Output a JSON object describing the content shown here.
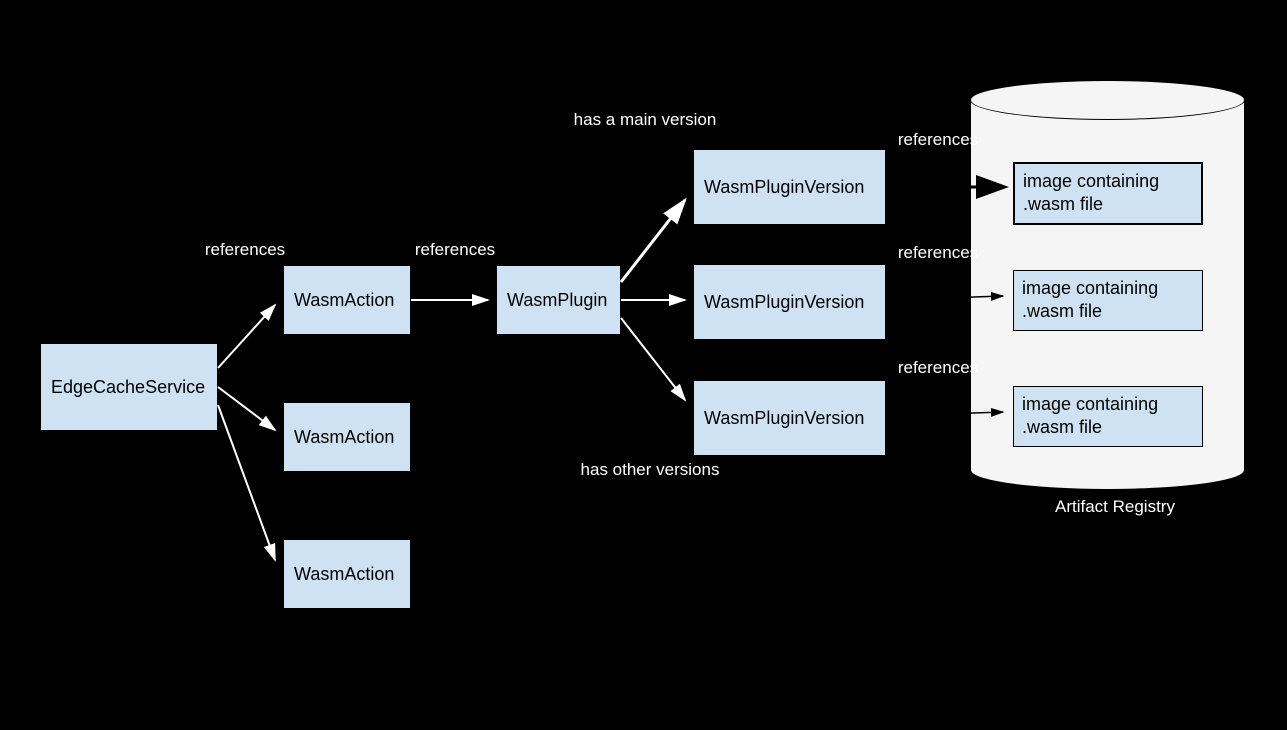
{
  "nodes": {
    "edgeCacheService": "EdgeCacheService",
    "wasmAction1": "WasmAction",
    "wasmAction2": "WasmAction",
    "wasmAction3": "WasmAction",
    "wasmPlugin": "WasmPlugin",
    "wasmPluginVersion1": "WasmPluginVersion",
    "wasmPluginVersion2": "WasmPluginVersion",
    "wasmPluginVersion3": "WasmPluginVersion",
    "image1": "image containing .wasm file",
    "image2": "image containing .wasm file",
    "image3": "image containing .wasm file"
  },
  "labels": {
    "references3x": "references",
    "references1": "references",
    "hasMainVersion": "has a main version",
    "hasOtherVersions": "has other versions",
    "references2": "references",
    "references3": "references",
    "references4": "references",
    "artifactRegistry": "Artifact Registry"
  },
  "colors": {
    "boxFill": "#cfe2f3",
    "cylinderFill": "#f5f5f5",
    "arrowWhite": "#ffffff",
    "arrowBlack": "#000000"
  }
}
